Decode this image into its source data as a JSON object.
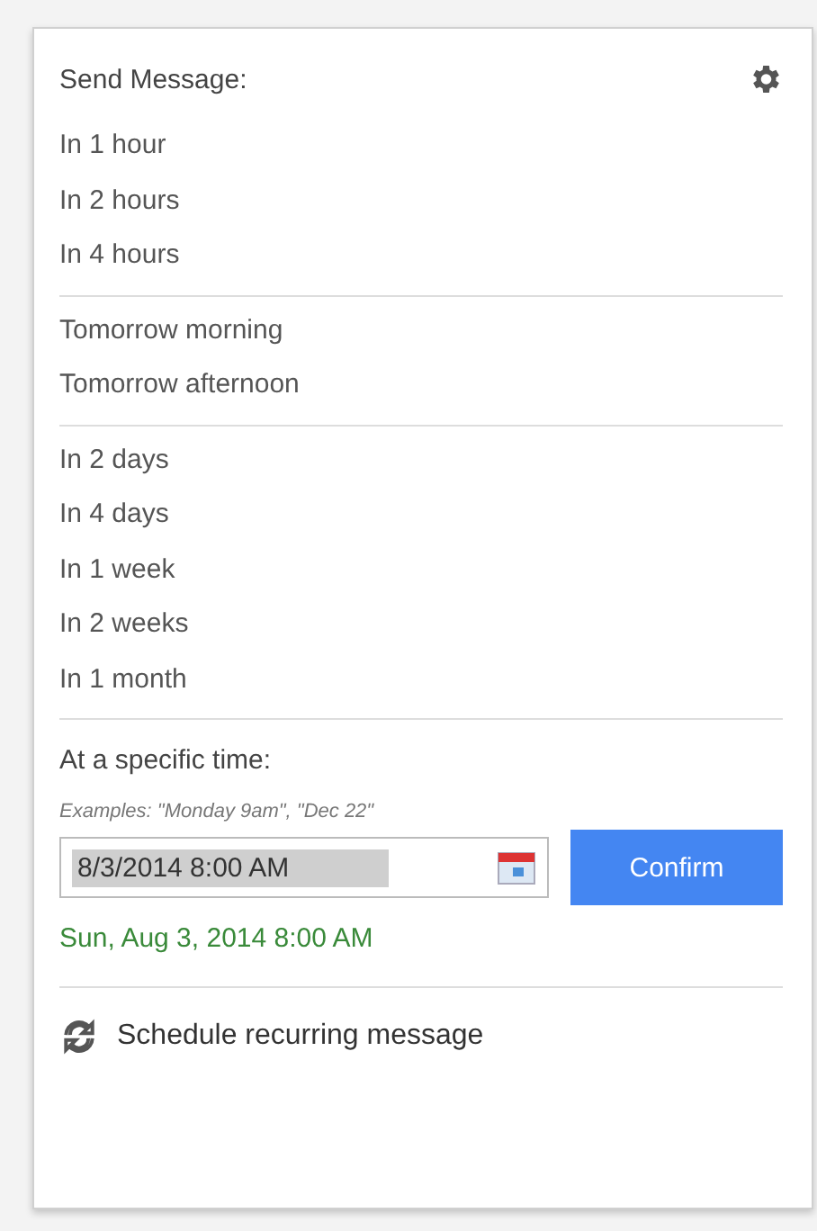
{
  "title": "Send Message:",
  "groups": [
    [
      "In 1 hour",
      "In 2 hours",
      "In 4 hours"
    ],
    [
      "Tomorrow morning",
      "Tomorrow afternoon"
    ],
    [
      "In 2 days",
      "In 4 days",
      "In 1 week",
      "In 2 weeks",
      "In 1 month"
    ]
  ],
  "specific": {
    "label": "At a specific time:",
    "examples": "Examples: \"Monday 9am\", \"Dec 22\"",
    "value": "8/3/2014 8:00 AM",
    "confirm": "Confirm",
    "parsed": "Sun, Aug 3, 2014 8:00 AM"
  },
  "recurring": "Schedule recurring message"
}
